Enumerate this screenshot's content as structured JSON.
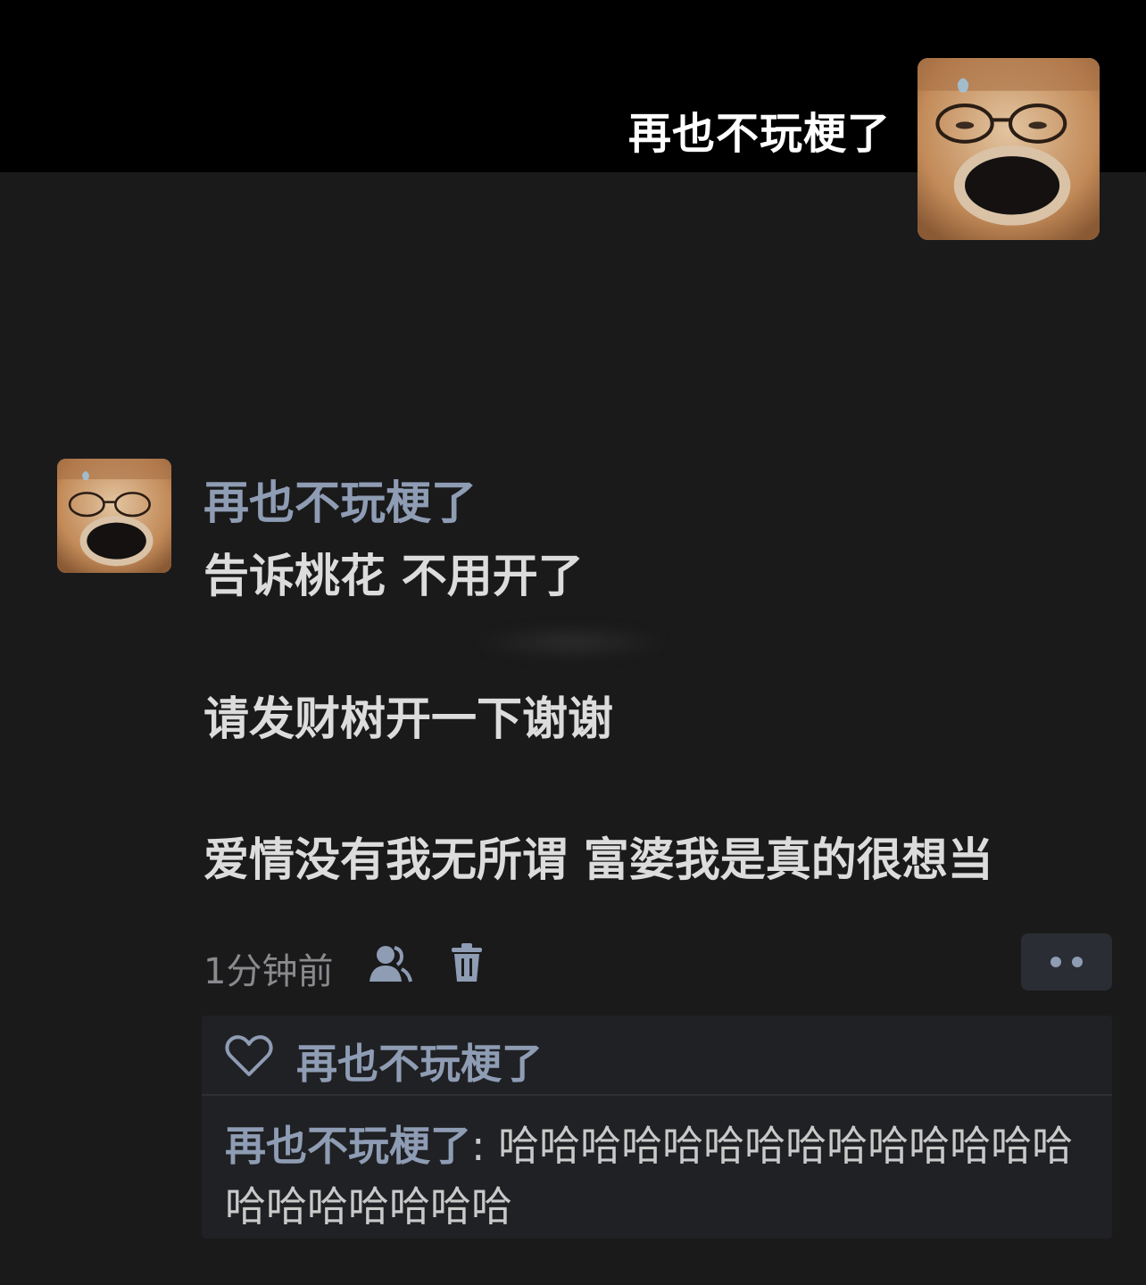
{
  "header": {
    "username": "再也不玩梗了",
    "avatar_icon": "shiba-dog-avatar-icon"
  },
  "post": {
    "author": "再也不玩梗了",
    "lines": [
      "告诉桃花 不用开了",
      "请发财树开一下谢谢",
      "爱情没有我无所谓 富婆我是真的很想当"
    ],
    "timestamp": "1分钟前",
    "icons": {
      "user": "user-icon",
      "delete": "trash-icon",
      "more": "more-dots-icon"
    }
  },
  "reply_section": {
    "liked_by": "再也不玩梗了",
    "like_icon": "heart-icon",
    "comment": {
      "author": "再也不玩梗了",
      "separator": ": ",
      "text": "哈哈哈哈哈哈哈哈哈哈哈哈哈哈哈哈哈哈哈哈哈"
    }
  },
  "colors": {
    "background": "#1a1a1b",
    "header_background": "#000000",
    "accent_name": "#8e9cb4",
    "body_text": "#dcdcdc"
  }
}
